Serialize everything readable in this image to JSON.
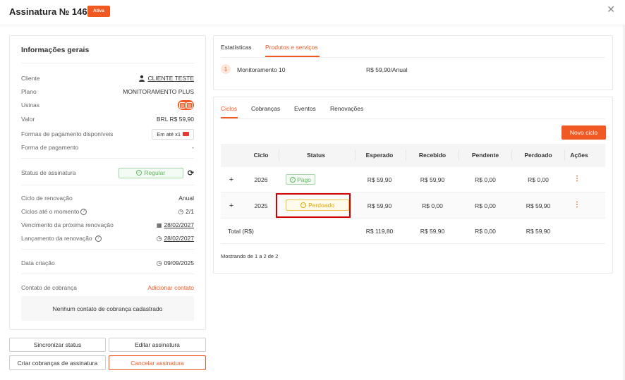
{
  "header": {
    "title": "Assinatura № 14646",
    "badge": "Ativa"
  },
  "left": {
    "title": "Informações gerais",
    "rows": {
      "cliente": {
        "label": "Cliente",
        "value": "CLIENTE TESTE"
      },
      "plano": {
        "label": "Plano",
        "value": "MONITORAMENTO PLUS"
      },
      "usinas": {
        "label": "Usinas"
      },
      "valor": {
        "label": "Valor",
        "value": "BRL R$ 59,90"
      },
      "formas": {
        "label": "Formas de pagamento disponíveis",
        "value": "Em até x1"
      },
      "forma": {
        "label": "Forma de pagamento",
        "value": "-"
      },
      "status": {
        "label": "Status de assinatura",
        "value": "Regular"
      },
      "ciclo": {
        "label": "Ciclo de renovação",
        "value": "Anual"
      },
      "ciclos": {
        "label": "Ciclos até o momento",
        "value": "2/1"
      },
      "vencimento": {
        "label": "Vencimento da próxima renovação",
        "value": "28/02/2027"
      },
      "lancamento": {
        "label": "Lançamento da renovação",
        "value": "28/02/2027"
      },
      "criacao": {
        "label": "Data criação",
        "value": "09/09/2025"
      },
      "contato": {
        "label": "Contato de cobrança",
        "value": "Adicionar contato"
      }
    },
    "empty_contact": "Nenhum contato de cobrança cadastrado"
  },
  "buttons": {
    "sync": "Sincronizar status",
    "edit": "Editar assinatura",
    "create": "Criar cobranças de assinatura",
    "cancel": "Cancelar assinatura"
  },
  "top_tabs": {
    "tab1": "Estatísticas",
    "tab2": "Produtos e serviços"
  },
  "product": {
    "index": "1",
    "name": "Monitoramento 10",
    "price": "R$ 59,90/Anual"
  },
  "bottom_tabs": {
    "t1": "Ciclos",
    "t2": "Cobranças",
    "t3": "Eventos",
    "t4": "Renovações"
  },
  "new_cycle": "Novo ciclo",
  "table": {
    "headers": {
      "ciclo": "Ciclo",
      "status": "Status",
      "esperado": "Esperado",
      "recebido": "Recebido",
      "pendente": "Pendente",
      "perdoado": "Perdoado",
      "acoes": "Ações"
    },
    "rows": [
      {
        "expand": "+",
        "ciclo": "2026",
        "status": "Pago",
        "esperado": "R$ 59,90",
        "recebido": "R$ 59,90",
        "pendente": "R$ 0,00",
        "perdoado": "R$ 0,00"
      },
      {
        "expand": "+",
        "ciclo": "2025",
        "status": "Perdoado",
        "esperado": "R$ 59,90",
        "recebido": "R$ 0,00",
        "pendente": "R$ 0,00",
        "perdoado": "R$ 59,90"
      }
    ],
    "total": {
      "label": "Total (R$)",
      "esperado": "R$ 119,80",
      "recebido": "R$ 59,90",
      "pendente": "R$ 0,00",
      "perdoado": "R$ 59,90"
    },
    "footer": "Mostrando de 1 a 2 de 2"
  },
  "colors": {
    "accent": "#f05a22",
    "success": "#5cb85c",
    "warning": "#e0a800",
    "highlight": "#d00000"
  }
}
